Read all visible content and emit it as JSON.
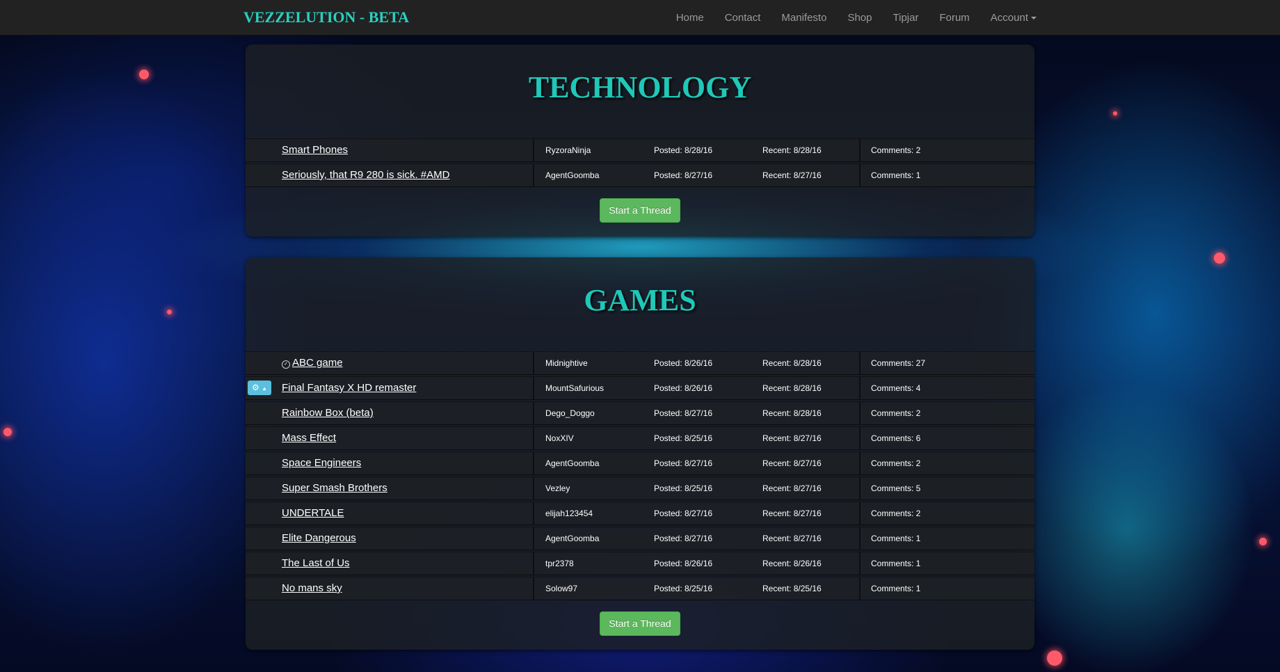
{
  "navbar": {
    "brand": "VEZZELUTION - BETA",
    "links": [
      "Home",
      "Contact",
      "Manifesto",
      "Shop",
      "Tipjar",
      "Forum"
    ],
    "account_label": "Account"
  },
  "sections": [
    {
      "title": "TECHNOLOGY",
      "start_thread_label": "Start a Thread",
      "threads": [
        {
          "title": "Smart Phones",
          "user": "RyzoraNinja",
          "posted": "Posted: 8/28/16",
          "recent": "Recent: 8/28/16",
          "comments": "Comments: 2"
        },
        {
          "title": "Seriously, that R9 280 is sick. #AMD",
          "user": "AgentGoomba",
          "posted": "Posted: 8/27/16",
          "recent": "Recent: 8/27/16",
          "comments": "Comments: 1"
        }
      ]
    },
    {
      "title": "GAMES",
      "start_thread_label": "Start a Thread",
      "threads": [
        {
          "title": "ABC game",
          "user": "Midnightive",
          "posted": "Posted: 8/26/16",
          "recent": "Recent: 8/28/16",
          "comments": "Comments: 27"
        },
        {
          "title": "Final Fantasy X HD remaster",
          "user": "MountSafurious",
          "posted": "Posted: 8/26/16",
          "recent": "Recent: 8/28/16",
          "comments": "Comments: 4"
        },
        {
          "title": "Rainbow Box (beta)",
          "user": "Dego_Doggo",
          "posted": "Posted: 8/27/16",
          "recent": "Recent: 8/28/16",
          "comments": "Comments: 2"
        },
        {
          "title": "Mass Effect",
          "user": "NoxXIV",
          "posted": "Posted: 8/25/16",
          "recent": "Recent: 8/27/16",
          "comments": "Comments: 6"
        },
        {
          "title": "Space Engineers",
          "user": "AgentGoomba",
          "posted": "Posted: 8/27/16",
          "recent": "Recent: 8/27/16",
          "comments": "Comments: 2"
        },
        {
          "title": "Super Smash Brothers",
          "user": "Vezley",
          "posted": "Posted: 8/25/16",
          "recent": "Recent: 8/27/16",
          "comments": "Comments: 5"
        },
        {
          "title": "UNDERTALE",
          "user": "elijah123454",
          "posted": "Posted: 8/27/16",
          "recent": "Recent: 8/27/16",
          "comments": "Comments: 2"
        },
        {
          "title": "Elite Dangerous",
          "user": "AgentGoomba",
          "posted": "Posted: 8/27/16",
          "recent": "Recent: 8/27/16",
          "comments": "Comments: 1"
        },
        {
          "title": "The Last of Us",
          "user": "tpr2378",
          "posted": "Posted: 8/26/16",
          "recent": "Recent: 8/26/16",
          "comments": "Comments: 1"
        },
        {
          "title": "No mans sky",
          "user": "Solow97",
          "posted": "Posted: 8/25/16",
          "recent": "Recent: 8/25/16",
          "comments": "Comments: 1"
        }
      ]
    }
  ],
  "icons": {
    "pinned": "pin-icon",
    "admin": "gear-icon"
  },
  "colors": {
    "brand": "#2ad0c0",
    "title": "#1fc8b8",
    "start_button": "#5cb85c",
    "admin_button": "#5bc0de"
  }
}
